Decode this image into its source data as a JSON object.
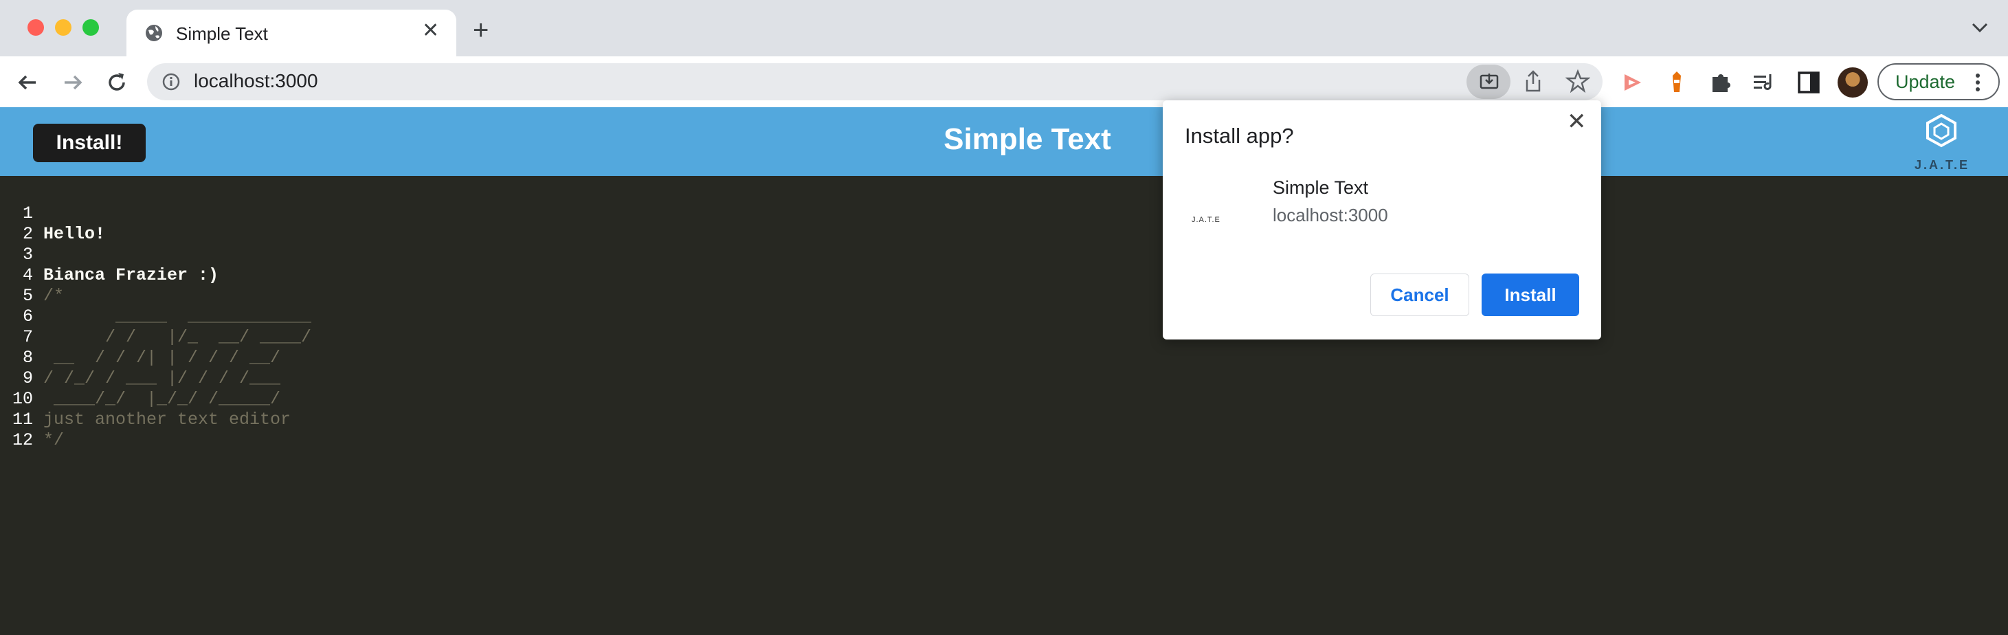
{
  "browser": {
    "tab_title": "Simple Text",
    "url": "localhost:3000",
    "update_label": "Update"
  },
  "app": {
    "install_label": "Install!",
    "title": "Simple Text",
    "logo_text": "J.A.T.E"
  },
  "editor": {
    "lines": [
      {
        "num": "1",
        "text": "Hello!",
        "style": "main"
      },
      {
        "num": "2",
        "text": "",
        "style": "main"
      },
      {
        "num": "3",
        "text": "Bianca Frazier :)",
        "style": "main"
      },
      {
        "num": "4",
        "text": "/*",
        "style": "comment"
      },
      {
        "num": "5",
        "text": "       _____  ____________",
        "style": "comment"
      },
      {
        "num": "6",
        "text": "      / /   |/_  __/ ____/",
        "style": "comment"
      },
      {
        "num": "7",
        "text": " __  / / /| | / / / __/",
        "style": "comment"
      },
      {
        "num": "8",
        "text": "/ /_/ / ___ |/ / / /___",
        "style": "comment"
      },
      {
        "num": "9",
        "text": " ____/_/  |_/_/ /_____/",
        "style": "comment"
      },
      {
        "num": "10",
        "text": "just another text editor",
        "style": "comment"
      },
      {
        "num": "11",
        "text": "*/",
        "style": "comment"
      },
      {
        "num": "12",
        "text": "",
        "style": "comment"
      }
    ]
  },
  "dialog": {
    "title": "Install app?",
    "app_name": "Simple Text",
    "origin": "localhost:3000",
    "icon_text": "J.A.T.E",
    "cancel_label": "Cancel",
    "install_label": "Install"
  },
  "colors": {
    "header": "#53a8dd",
    "editor_bg": "#272822",
    "accent": "#1a73e8"
  }
}
